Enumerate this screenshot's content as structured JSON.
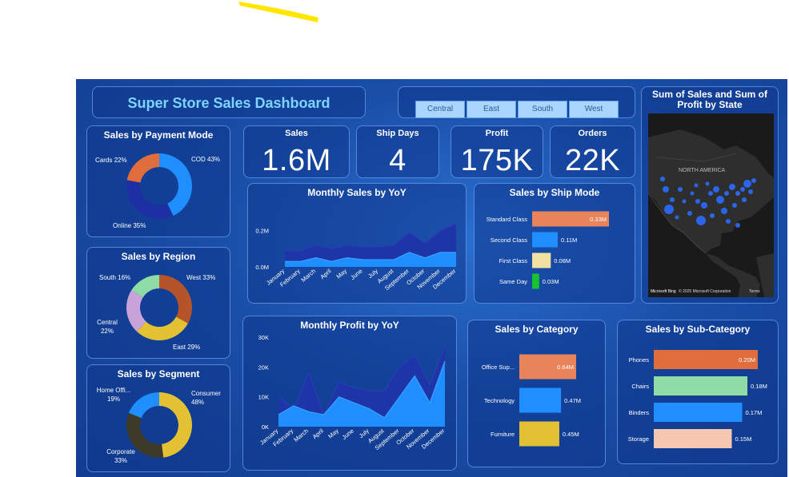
{
  "dashboard": {
    "title": "Super Store Sales Dashboard",
    "regions": [
      "Central",
      "East",
      "South",
      "West"
    ]
  },
  "kpis": {
    "sales": {
      "label": "Sales",
      "value": "1.6M"
    },
    "ship_days": {
      "label": "Ship Days",
      "value": "4"
    },
    "profit": {
      "label": "Profit",
      "value": "175K"
    },
    "orders": {
      "label": "Orders",
      "value": "22K"
    }
  },
  "map": {
    "title": "Sum of Sales and Sum of Profit by State",
    "continent_label": "NORTH AMERICA",
    "credit": "© 2025 Microsoft Corporation",
    "terms": "Terms",
    "brand": "Microsoft Bing"
  },
  "colors": {
    "orange": "#e8835a",
    "blue": "#1f8fff",
    "navy": "#1e2fa3",
    "green": "#16c42e",
    "beige": "#f1e2a4",
    "mint": "#8fdca6",
    "brown": "#b5542a",
    "lilac": "#c8a2d8",
    "mustard": "#e2c233",
    "darkolive": "#3d3a2a",
    "peach": "#f5c7b0",
    "coral": "#e06d3c"
  },
  "chart_data": [
    {
      "id": "payment",
      "type": "pie",
      "title": "Sales by Payment Mode",
      "slices": [
        {
          "label": "COD 43%",
          "value": 43
        },
        {
          "label": "Online 35%",
          "value": 35
        },
        {
          "label": "Cards 22%",
          "value": 22
        }
      ]
    },
    {
      "id": "region",
      "type": "pie",
      "title": "Sales by Region",
      "slices": [
        {
          "label": "West 33%",
          "value": 33
        },
        {
          "label": "East 29%",
          "value": 29
        },
        {
          "label": "Central 22%",
          "value": 22
        },
        {
          "label": "South 16%",
          "value": 16
        }
      ]
    },
    {
      "id": "segment",
      "type": "pie",
      "title": "Sales by Segment",
      "slices": [
        {
          "label": "Consumer 48%",
          "value": 48
        },
        {
          "label": "Corporate 33%",
          "value": 33
        },
        {
          "label": "Home Offi... 19%",
          "value": 19
        }
      ]
    },
    {
      "id": "monthly_sales",
      "type": "area",
      "title": "Monthly Sales by YoY",
      "categories": [
        "January",
        "February",
        "March",
        "April",
        "May",
        "June",
        "July",
        "August",
        "September",
        "October",
        "November",
        "December"
      ],
      "yticks": [
        "0.0M",
        "0.2M"
      ],
      "ylim": [
        0,
        0.3
      ],
      "series": [
        {
          "values": [
            0.09,
            0.09,
            0.12,
            0.1,
            0.12,
            0.11,
            0.11,
            0.12,
            0.19,
            0.13,
            0.2,
            0.24
          ]
        },
        {
          "values": [
            0.03,
            0.03,
            0.05,
            0.03,
            0.05,
            0.04,
            0.04,
            0.04,
            0.08,
            0.05,
            0.08,
            0.08
          ]
        }
      ]
    },
    {
      "id": "ship_mode",
      "type": "bar",
      "title": "Sales by Ship Mode",
      "categories": [
        "Standard Class",
        "Second Class",
        "First Class",
        "Same Day"
      ],
      "values": [
        0.33,
        0.11,
        0.08,
        0.03
      ],
      "value_labels": [
        "0.33M",
        "0.11M",
        "0.08M",
        "0.03M"
      ]
    },
    {
      "id": "monthly_profit",
      "type": "area",
      "title": "Monthly Profit by YoY",
      "categories": [
        "January",
        "February",
        "March",
        "April",
        "May",
        "June",
        "July",
        "August",
        "September",
        "October",
        "November",
        "December"
      ],
      "yticks": [
        "0K",
        "10K",
        "20K",
        "30K"
      ],
      "ylim": [
        0,
        30
      ],
      "series": [
        {
          "values": [
            10,
            6,
            18,
            4,
            15,
            13,
            12,
            12,
            20,
            24,
            14,
            27
          ]
        },
        {
          "values": [
            4,
            7,
            5,
            4,
            10,
            8,
            6,
            3,
            10,
            17,
            8,
            22
          ]
        }
      ]
    },
    {
      "id": "category",
      "type": "bar",
      "title": "Sales by Category",
      "categories": [
        "Office Sup...",
        "Technology",
        "Furniture"
      ],
      "values": [
        0.64,
        0.47,
        0.45
      ],
      "value_labels": [
        "0.64M",
        "0.47M",
        "0.45M"
      ]
    },
    {
      "id": "subcategory",
      "type": "bar",
      "title": "Sales by Sub-Category",
      "categories": [
        "Phones",
        "Chairs",
        "Binders",
        "Storage"
      ],
      "values": [
        0.2,
        0.18,
        0.17,
        0.15
      ],
      "value_labels": [
        "0.20M",
        "0.18M",
        "0.17M",
        "0.15M"
      ]
    }
  ]
}
